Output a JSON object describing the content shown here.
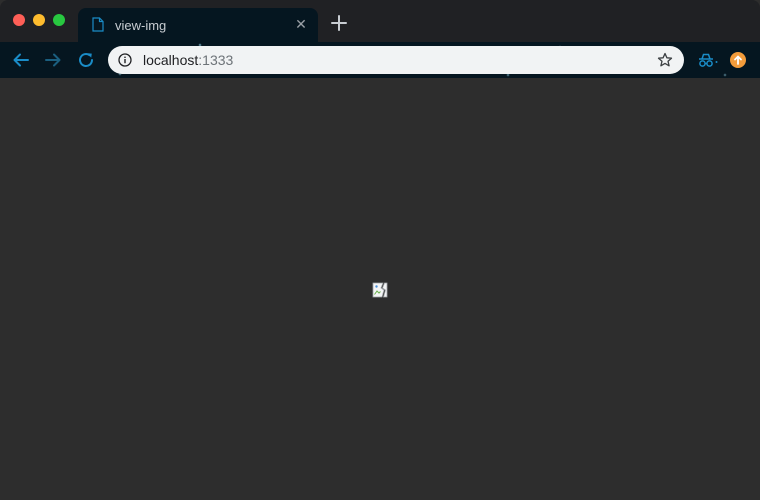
{
  "window": {
    "controls": [
      "close",
      "minimize",
      "maximize"
    ]
  },
  "tab": {
    "title": "view-img",
    "icon": "document-icon",
    "close_icon": "close-icon"
  },
  "toolbar": {
    "back_icon": "arrow-left-icon",
    "forward_icon": "arrow-right-icon",
    "reload_icon": "reload-icon",
    "url_host": "localhost",
    "url_port": ":1333",
    "info_icon": "info-icon",
    "bookmark_icon": "star-icon",
    "extensions": [
      "incognito-icon",
      "update-icon"
    ]
  },
  "content": {
    "image_state": "broken-image-icon"
  },
  "colors": {
    "titlebar": "#202124",
    "toolbar": "#051620",
    "accent": "#1a8cc7",
    "content_bg": "#2d2d2d",
    "omnibox": "#f1f3f4"
  }
}
